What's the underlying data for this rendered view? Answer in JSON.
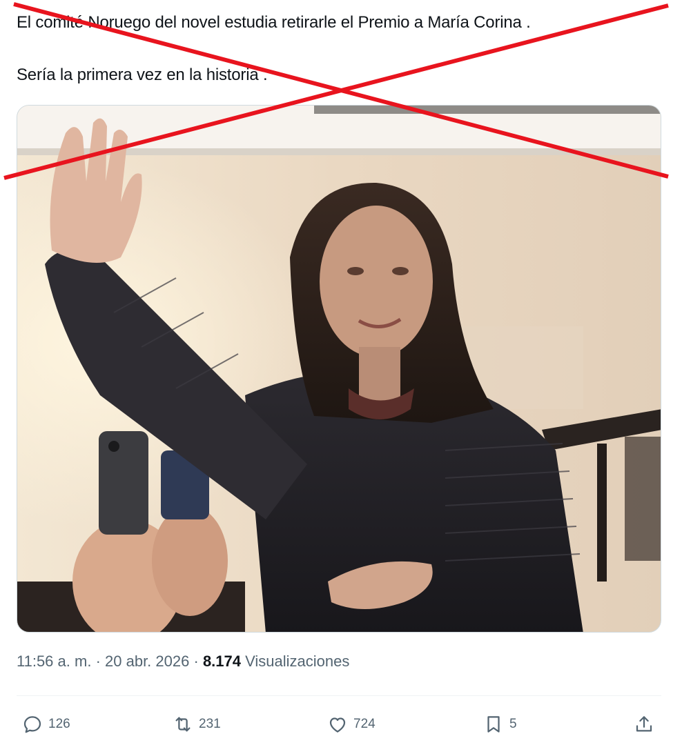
{
  "tweet": {
    "lines": [
      "El comité Noruego del novel estudia retirarle el Premio a María Corina .",
      "Sería la primera vez en la historia ."
    ]
  },
  "meta": {
    "time": "11:56 a. m.",
    "separator": "·",
    "date": "20 abr. 2026",
    "views_count": "8.174",
    "views_label": "Visualizaciones"
  },
  "actions": {
    "replies": "126",
    "reposts": "231",
    "likes": "724",
    "bookmarks": "5"
  },
  "colors": {
    "text": "#0f1419",
    "muted": "#536471",
    "cross": "#e8141e"
  },
  "icons": [
    "reply-icon",
    "repost-icon",
    "like-icon",
    "bookmark-icon",
    "share-icon"
  ]
}
